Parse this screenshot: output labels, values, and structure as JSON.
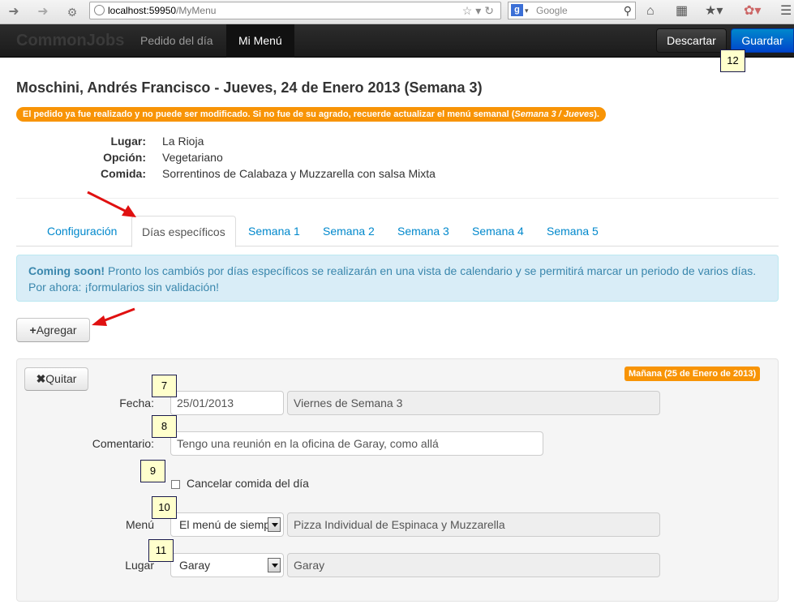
{
  "browser": {
    "url_host": "localhost:59950",
    "url_path": "/MyMenu",
    "search_placeholder": "Google"
  },
  "navbar": {
    "brand": "CommonJobs",
    "links": [
      "Pedido del día",
      "Mi Menú"
    ],
    "active_link": "Mi Menú",
    "discard_label": "Descartar",
    "save_label": "Guardar"
  },
  "callouts": [
    "7",
    "8",
    "9",
    "10",
    "11",
    "12"
  ],
  "header": {
    "title": "Moschini, Andrés Francisco - Jueves, 24 de Enero 2013 (Semana 3)",
    "warning_text": "El pedido ya fue realizado y no puede ser modificado. Si no fue de su agrado, recuerde actualizar el menú semanal (",
    "warning_em": "Semana 3 / Jueves",
    "warning_end": ")."
  },
  "info": [
    {
      "label": "Lugar:",
      "value": "La Rioja"
    },
    {
      "label": "Opción:",
      "value": "Vegetariano"
    },
    {
      "label": "Comida:",
      "value": "Sorrentinos de Calabaza y Muzzarella con salsa Mixta"
    }
  ],
  "tabs": [
    "Configuración",
    "Días específicos",
    "Semana 1",
    "Semana 2",
    "Semana 3",
    "Semana 4",
    "Semana 5"
  ],
  "active_tab": "Días específicos",
  "notice": {
    "bold": "Coming soon!",
    "text": " Pronto los cambiós por días específicos se realizarán en una vista de calendario y se permitirá marcar un periodo de varios días. Por ahora: ¡formularios sin validación!"
  },
  "add_button": "Agregar",
  "entry": {
    "remove_button": "Quitar",
    "badge": "Mañana (25 de Enero de 2013)",
    "fecha_label": "Fecha:",
    "fecha_value": "25/01/2013",
    "fecha_readonly": "Viernes de Semana 3",
    "comentario_label": "Comentario:",
    "comentario_value": "Tengo una reunión en la oficina de Garay, como allá",
    "cancel_label": "Cancelar comida del día",
    "menu_label": "Menú",
    "menu_selected": "El menú de siempre",
    "menu_readonly": "Pizza Individual de Espinaca y Muzzarella",
    "lugar_label": "Lugar",
    "lugar_selected": "Garay",
    "lugar_readonly": "Garay"
  },
  "colors": {
    "navbar": "#1b1b1b",
    "primary": "#0088cc",
    "warning": "#f89406",
    "info_bg": "#d9edf7",
    "callout_bg": "#ffffcc"
  }
}
